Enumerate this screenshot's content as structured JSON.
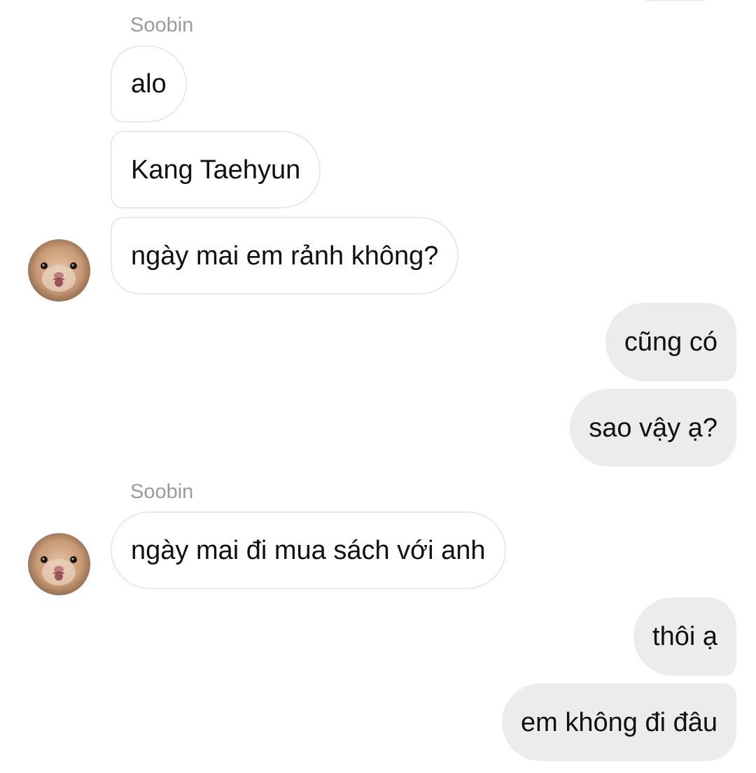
{
  "conversation": {
    "groups": [
      {
        "sender": "Soobin",
        "messages": [
          {
            "text": "alo"
          },
          {
            "text": "Kang Taehyun"
          },
          {
            "text": "ngày mai em rảnh không?"
          }
        ]
      },
      {
        "sender": "me",
        "messages": [
          {
            "text": "cũng có"
          },
          {
            "text": "sao vậy ạ?"
          }
        ]
      },
      {
        "sender": "Soobin",
        "messages": [
          {
            "text": "ngày mai đi mua sách với anh"
          }
        ]
      },
      {
        "sender": "me",
        "messages": [
          {
            "text": "thôi ạ"
          },
          {
            "text": "em không đi đâu"
          }
        ]
      }
    ]
  },
  "colors": {
    "incoming_bubble_bg": "#ffffff",
    "incoming_bubble_border": "#e9e9e9",
    "outgoing_bubble_bg": "#ececec",
    "sender_name": "#9b9b9b",
    "message_text": "#111111"
  },
  "icons": {
    "contact_avatar": "hamster-avatar"
  }
}
